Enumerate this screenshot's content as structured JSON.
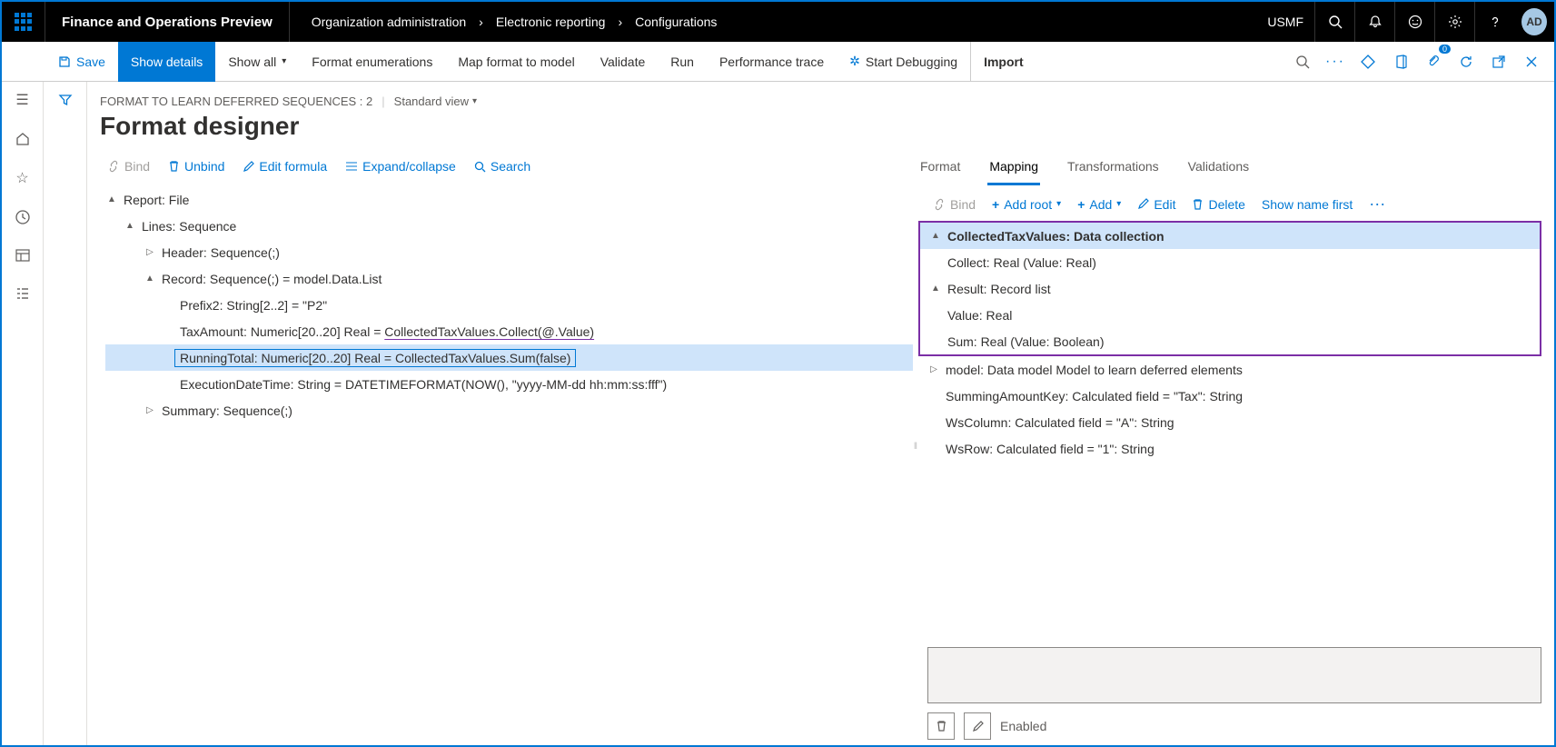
{
  "topbar": {
    "brand": "Finance and Operations Preview",
    "breadcrumb": [
      "Organization administration",
      "Electronic reporting",
      "Configurations"
    ],
    "entity": "USMF",
    "avatar": "AD"
  },
  "cmdbar": {
    "save": "Save",
    "showDetails": "Show details",
    "showAll": "Show all",
    "formatEnum": "Format enumerations",
    "mapFormat": "Map format to model",
    "validate": "Validate",
    "run": "Run",
    "perfTrace": "Performance trace",
    "startDebug": "Start Debugging",
    "import": "Import"
  },
  "page": {
    "meta": "FORMAT TO LEARN DEFERRED SEQUENCES : 2",
    "stdview": "Standard view",
    "title": "Format designer"
  },
  "leftActions": {
    "bind": "Bind",
    "unbind": "Unbind",
    "editFormula": "Edit formula",
    "expand": "Expand/collapse",
    "search": "Search"
  },
  "formatTree": {
    "n0": "Report: File",
    "n1": "Lines: Sequence",
    "n2": "Header: Sequence(;)",
    "n3": "Record: Sequence(;) = model.Data.List",
    "n4": "Prefix2: String[2..2] = \"P2\"",
    "n5a": "TaxAmount: Numeric[20..20] Real = ",
    "n5b": "CollectedTaxValues.Collect(@.Value)",
    "n6a": "RunningTotal: Numeric[20..20] Real = ",
    "n6b": "CollectedTaxValues.Sum(false)",
    "n7": "ExecutionDateTime: String = DATETIMEFORMAT(NOW(), \"yyyy-MM-dd hh:mm:ss:fff\")",
    "n8": "Summary: Sequence(;)"
  },
  "tabs": {
    "format": "Format",
    "mapping": "Mapping",
    "transformations": "Transformations",
    "validations": "Validations"
  },
  "mapActions": {
    "bind": "Bind",
    "addRoot": "Add root",
    "add": "Add",
    "edit": "Edit",
    "delete": "Delete",
    "showName": "Show name first"
  },
  "mapTree": {
    "m0": "CollectedTaxValues: Data collection",
    "m1": "Collect: Real (Value: Real)",
    "m2": "Result: Record list",
    "m3": "Value: Real",
    "m4": "Sum: Real (Value: Boolean)",
    "m5": "model: Data model Model to learn deferred elements",
    "m6": "SummingAmountKey: Calculated field = \"Tax\": String",
    "m7": "WsColumn: Calculated field = \"A\": String",
    "m8": "WsRow: Calculated field = \"1\": String"
  },
  "bottom": {
    "enabled": "Enabled"
  }
}
